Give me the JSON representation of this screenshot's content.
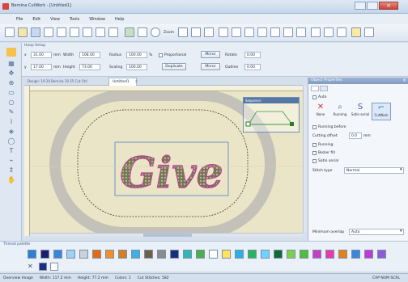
{
  "app": {
    "title": "Bernina CutWork - [Untitled1]"
  },
  "menu": [
    "File",
    "Edit",
    "View",
    "Tools",
    "Window",
    "Help"
  ],
  "toolbar": {
    "zoom_label": "Zoom"
  },
  "object_panel": {
    "title": "Hoop Setup",
    "row1": {
      "x_label": "x",
      "x_val": "31.00",
      "unit": "mm",
      "w_label": "Width",
      "w_val": "108.00",
      "radius_label": "Radius",
      "radius_val": "100.00",
      "pct": "%",
      "proportional": "Proportional",
      "mirror": "Mirror",
      "rotate_label": "Rotate",
      "rotate_val": "0.00"
    },
    "row2": {
      "y_label": "y",
      "y_val": "17.00",
      "h_label": "Height",
      "h_val": "73.00",
      "scale_label": "Scaling",
      "scale_val": "100.00",
      "duplicate": "Duplicate",
      "mirror": "Mirror",
      "outline_label": "Outline",
      "outline_val": "0.00"
    }
  },
  "doc_tab": {
    "label": "Untitled1",
    "info": "Design: 19  20  Bernina 19  25  Cut  Ctrl"
  },
  "canvas": {
    "design_text": "Give",
    "sequence_label": "Sequence"
  },
  "properties": {
    "title": "Object Properties",
    "auto_label": "Auto",
    "tools": [
      "None",
      "Running",
      "Satin serial",
      "CutWork"
    ],
    "running_before": "Running before",
    "cutting_offset_label": "Cutting offset",
    "cutting_offset_val": "0.0",
    "cutting_offset_unit": "mm",
    "options": [
      "Running",
      "Bezier fill",
      "Satin serial"
    ],
    "stitch_type_label": "Stitch type",
    "stitch_type_val": "Normal",
    "mean_overlap_label": "Minimum overlap",
    "mean_overlap_val": "Auto"
  },
  "palette": {
    "title": "Thread palette",
    "colors": [
      "#2f7fd3",
      "#1c1c6f",
      "#3a86d9",
      "#9ed1f2",
      "#c7d3dc",
      "#e46a12",
      "#f08f30",
      "#d77c20",
      "#3fb0e3",
      "#6d5e48",
      "#8b8b8b",
      "#1c2d80",
      "#2fb7b2",
      "#46b04a",
      "#ffffff",
      "#ffe35a",
      "#2cb0e3",
      "#28b45a",
      "#6fd3ff",
      "#0f6a35",
      "#7bd14a",
      "#4fbf36",
      "#c53ec4",
      "#e83aa8",
      "#e87f16",
      "#3a86d9",
      "#bf3ad1",
      "#8e5bd6"
    ]
  },
  "status": {
    "fields": [
      "Overview Image",
      "Width: 117.2 mm",
      "Height: 77.2 mm",
      "Colors: 1",
      "Cut Stitches: 582"
    ],
    "right": "CAP NUM SCRL"
  }
}
